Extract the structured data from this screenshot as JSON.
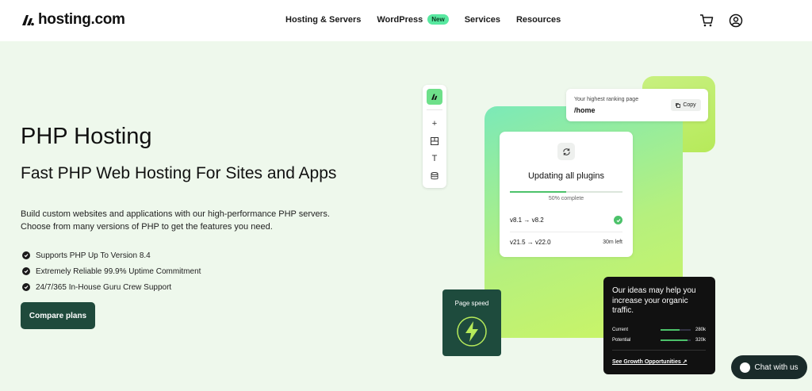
{
  "header": {
    "logo_text": "hosting.com",
    "nav": [
      {
        "label": "Hosting & Servers"
      },
      {
        "label": "WordPress",
        "badge": "New"
      },
      {
        "label": "Services"
      },
      {
        "label": "Resources"
      }
    ],
    "icons": [
      "cart-icon",
      "account-icon"
    ]
  },
  "hero": {
    "title": "PHP Hosting",
    "subtitle": "Fast PHP Web Hosting For Sites and Apps",
    "description": "Build custom websites and applications with our high-performance PHP servers. Choose from many versions of PHP to get the features you need.",
    "features": [
      "Supports PHP Up To Version 8.4",
      "Extremely Reliable 99.9% Uptime Commitment",
      "24/7/365 In-House Guru Crew Support"
    ],
    "cta_label": "Compare plans"
  },
  "visual": {
    "rank_card": {
      "label": "Your highest ranking page",
      "path": "/home",
      "copy_label": "Copy"
    },
    "update_card": {
      "title": "Updating all plugins",
      "progress_text": "50% complete",
      "progress_value": 0.5,
      "rows": [
        {
          "version": "v8.1 → v8.2",
          "status": "done"
        },
        {
          "version": "v21.5 → v22.0",
          "eta": "30m left"
        }
      ]
    },
    "speed_card": {
      "label": "Page speed"
    },
    "growth_card": {
      "title": "Our ideas may help you increase your organic traffic.",
      "rows": [
        {
          "name": "Current",
          "value": "280k",
          "fraction": 0.62
        },
        {
          "name": "Potential",
          "value": "320k",
          "fraction": 0.9
        }
      ],
      "link": "See Growth Opportunities ↗"
    }
  },
  "chat": {
    "label": "Chat with us"
  },
  "colors": {
    "brand_dark": "#1f4a3c",
    "accent_green": "#4cc26a",
    "bg": "#eef8ec"
  }
}
